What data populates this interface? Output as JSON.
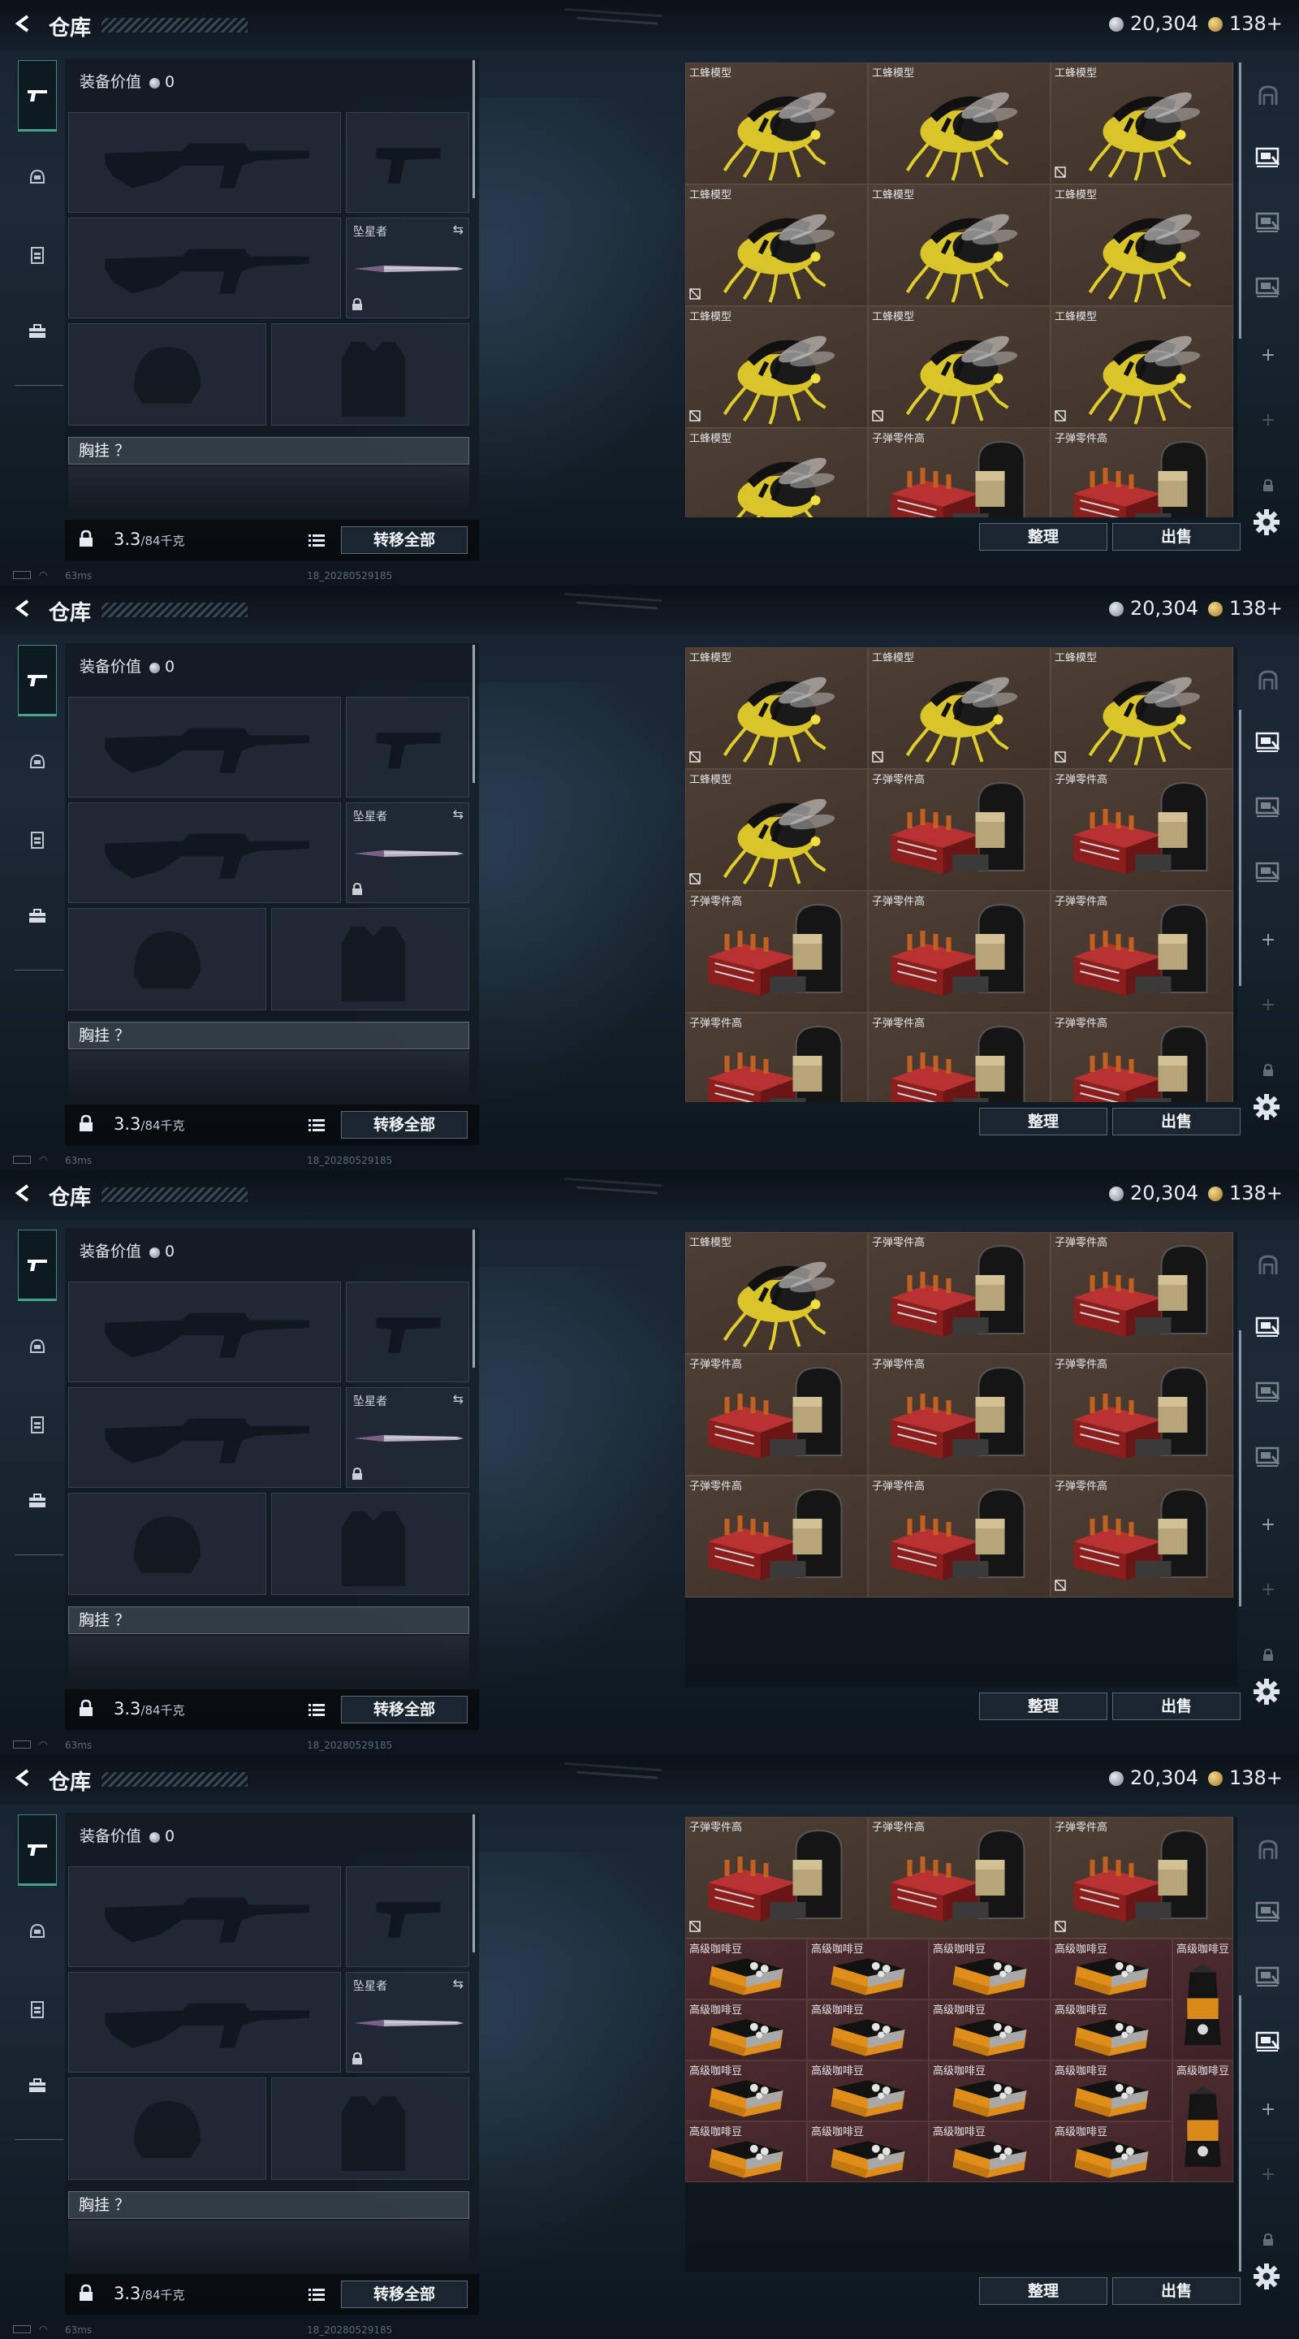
{
  "header": {
    "back_icon": "chevron-left-icon",
    "title": "仓库"
  },
  "currency": {
    "silver": "20,304",
    "gold": "138+"
  },
  "loadout": {
    "equip_value_label": "装备价值",
    "equip_value": "0",
    "melee_label": "坠星者",
    "chest_label": "胸挂 ？",
    "weight_current": "3.3",
    "weight_max": "/84千克",
    "transfer_all": "转移全部"
  },
  "stash_actions": {
    "sort": "整理",
    "sell": "出售"
  },
  "status": {
    "ping": "63ms",
    "build": "18_20280529185"
  },
  "item_names": {
    "drone": "工蜂模型",
    "ammo": "子弹零件高",
    "coffee": "高级咖啡豆"
  },
  "colors": {
    "accent": "#41a58a",
    "brown_tile": "#4a3b31",
    "maroon_tile": "#4b2a2e",
    "drone_yellow": "#e3d12c"
  },
  "screens": [
    {
      "scroll_fraction": 0.0,
      "rows": [
        [
          "drone",
          "drone",
          "drone"
        ],
        [
          "drone",
          "drone",
          "drone"
        ],
        [
          "drone",
          "drone",
          "drone"
        ],
        [
          "drone",
          "ammo",
          "ammo"
        ]
      ],
      "marks": [
        [
          false,
          false,
          true
        ],
        [
          true,
          false,
          false
        ],
        [
          true,
          true,
          true
        ],
        [
          false,
          false,
          false
        ]
      ]
    },
    {
      "scroll_fraction": 0.35,
      "rows": [
        [
          "drone",
          "drone",
          "drone"
        ],
        [
          "drone",
          "ammo",
          "ammo"
        ],
        [
          "ammo",
          "ammo",
          "ammo"
        ],
        [
          "ammo",
          "ammo",
          "ammo"
        ]
      ],
      "marks": [
        [
          true,
          true,
          true
        ],
        [
          true,
          false,
          false
        ],
        [
          false,
          false,
          false
        ],
        [
          false,
          false,
          true
        ]
      ]
    },
    {
      "scroll_fraction": 0.55,
      "rows": [
        [
          "drone",
          "ammo",
          "ammo"
        ],
        [
          "ammo",
          "ammo",
          "ammo"
        ],
        [
          "ammo",
          "ammo",
          "ammo"
        ]
      ],
      "marks": [
        [
          false,
          false,
          false
        ],
        [
          false,
          false,
          false
        ],
        [
          false,
          false,
          true
        ]
      ]
    },
    {
      "scroll_fraction": 1.0,
      "rows": [
        [
          "ammo",
          "ammo",
          "ammo"
        ]
      ],
      "marks": [
        [
          true,
          false,
          true
        ]
      ],
      "coffee_grid": true
    }
  ]
}
